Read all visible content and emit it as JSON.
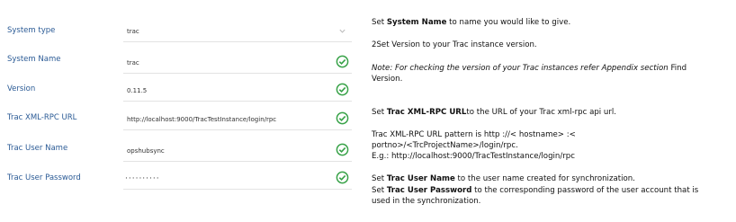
{
  "form": {
    "rows": [
      {
        "label": "System type",
        "value": "trac",
        "control": "select"
      },
      {
        "label": "System Name",
        "value": "trac",
        "control": "text",
        "valid": true
      },
      {
        "label": "Version",
        "value": "0.11.5",
        "control": "text",
        "valid": true
      },
      {
        "label": "Trac XML-RPC URL",
        "value": "http://localhost:9000/TracTestInstance/login/rpc",
        "control": "text",
        "valid": true
      },
      {
        "label": "Trac User Name",
        "value": "opshubsync",
        "control": "text",
        "valid": true
      },
      {
        "label": "Trac User Password",
        "value": "··········",
        "control": "password",
        "valid": true
      }
    ],
    "icons": {
      "dropdown": "chevron-down-icon",
      "valid": "check-circle-icon"
    },
    "colors": {
      "label": "#2a5a95",
      "check": "#3aa34a",
      "chevron": "#bbbbbb"
    }
  },
  "help": {
    "p1": {
      "pre": "Set ",
      "bold": "System Name",
      "post": " to name you would like to give."
    },
    "p2": "2Set Version to your Trac instance version.",
    "p3": {
      "italic": "Note: For checking the version of your Trac instances refer Appendix section",
      "post": " Find",
      "line2": "Version."
    },
    "p4": {
      "pre": "Set ",
      "bold": "Trac XML-RPC URL",
      "post": "to the URL of your Trac xml-rpc api url."
    },
    "p5": {
      "line1": "Trac XML-RPC URL pattern is http ://< hostname> :<",
      "line2": "portno>/<TrcProjectName>/login/rpc.",
      "line3": "E.g.: http://localhost:9000/TracTestInstance/login/rpc"
    },
    "p6": {
      "pre": "Set ",
      "bold": "Trac User Name",
      "post": " to the user name created for synchronization."
    },
    "p7": {
      "pre": "Set ",
      "bold": "Trac User Password",
      "post": " to the corresponding password of the user account that is",
      "line2": "used in the synchronization."
    }
  }
}
